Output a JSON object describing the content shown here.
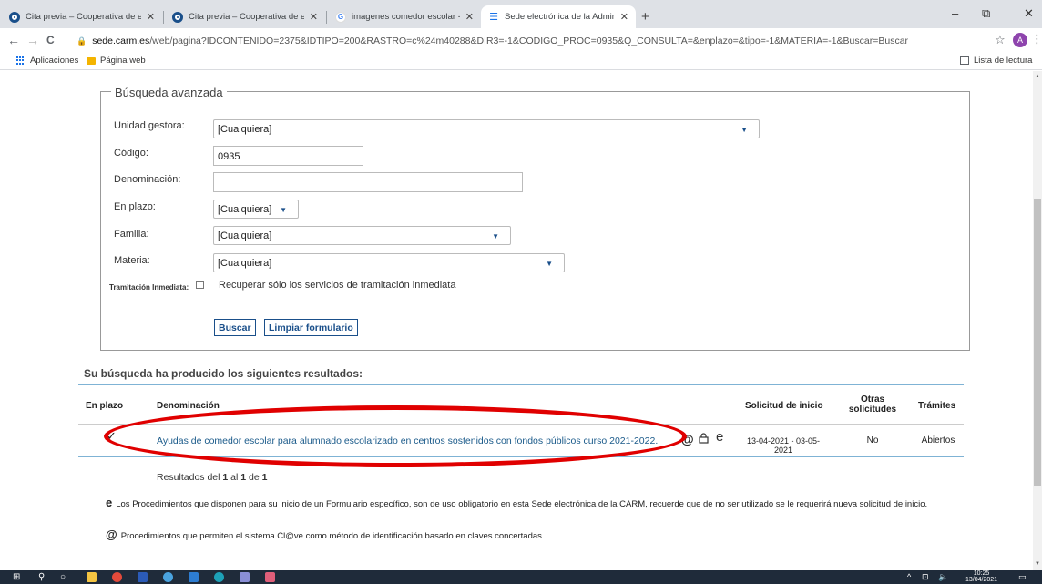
{
  "browser": {
    "tabs": [
      {
        "label": "Cita previa – Cooperativa de ense",
        "close": "✕"
      },
      {
        "label": "Cita previa – Cooperativa de ense",
        "close": "✕"
      },
      {
        "label": "imagenes comedor escolar - Bús",
        "close": "✕"
      },
      {
        "label": "Sede electrónica de la Administr",
        "close": "✕"
      }
    ],
    "new_tab": "+",
    "controls": {
      "minimize": "–",
      "restore": "⧉",
      "close": "✕"
    },
    "nav": {
      "back": "←",
      "forward": "→",
      "reload": "C"
    },
    "address": {
      "host": "sede.carm.es",
      "path": "/web/pagina?IDCONTENIDO=2375&IDTIPO=200&RASTRO=c%24m40288&DIR3=-1&CODIGO_PROC=0935&Q_CONSULTA=&enplazo=&tipo=-1&MATERIA=-1&Buscar=Buscar"
    },
    "avatar_letter": "A",
    "bookmarks": {
      "apps": "Aplicaciones",
      "webpage": "Página web",
      "reading_list": "Lista de lectura"
    }
  },
  "form": {
    "legend": "Búsqueda avanzada",
    "fields": {
      "unidad": {
        "label": "Unidad gestora:",
        "value": "[Cualquiera]"
      },
      "codigo": {
        "label": "Código:",
        "value": "0935"
      },
      "denominacion": {
        "label": "Denominación:",
        "value": ""
      },
      "en_plazo": {
        "label": "En plazo:",
        "value": "[Cualquiera]"
      },
      "familia": {
        "label": "Familia:",
        "value": "[Cualquiera]"
      },
      "materia": {
        "label": "Materia:",
        "value": "[Cualquiera]"
      }
    },
    "tramitacion": {
      "label": "Tramitación Inmediata:",
      "text": "Recuperar sólo los servicios de tramitación inmediata"
    },
    "buttons": {
      "search": "Buscar",
      "clear": "Limpiar formulario"
    }
  },
  "results": {
    "title": "Su búsqueda ha producido los siguientes resultados:",
    "headers": {
      "en_plazo": "En plazo",
      "denominacion": "Denominación",
      "solicitud": "Solicitud de inicio",
      "otras_1": "Otras",
      "otras_2": "solicitudes",
      "tramites": "Trámites"
    },
    "row": {
      "check": "✓",
      "title": "Ayudas de comedor escolar para alumnado escolarizado en centros sostenidos con fondos públicos curso 2021-2022.",
      "icon_at": "@",
      "icon_e": "e",
      "dates": "13-04-2021 - 03-05-2021",
      "otras": "No",
      "tramites": "Abiertos"
    },
    "count": {
      "prefix": "Resultados del",
      "from": "1",
      "mid1": "al",
      "to": "1",
      "mid2": "de",
      "total": "1"
    }
  },
  "notes": {
    "e_symbol": "e",
    "e_text": "Los Procedimientos que disponen para su inicio de un Formulario específico, son de uso obligatorio en esta Sede electrónica de la CARM, recuerde que de no ser utilizado se le requerirá nueva solicitud de inicio.",
    "at_symbol": "@",
    "at_text": "Procedimientos que permiten el sistema Cl@ve como método de identificación basado en claves concertadas."
  },
  "taskbar": {
    "time": "10:25",
    "date": "13/04/2021"
  },
  "colors": {
    "annotation_ellipse": "#e00000",
    "link": "#1a5a8a",
    "accent": "#1a4f8a"
  }
}
